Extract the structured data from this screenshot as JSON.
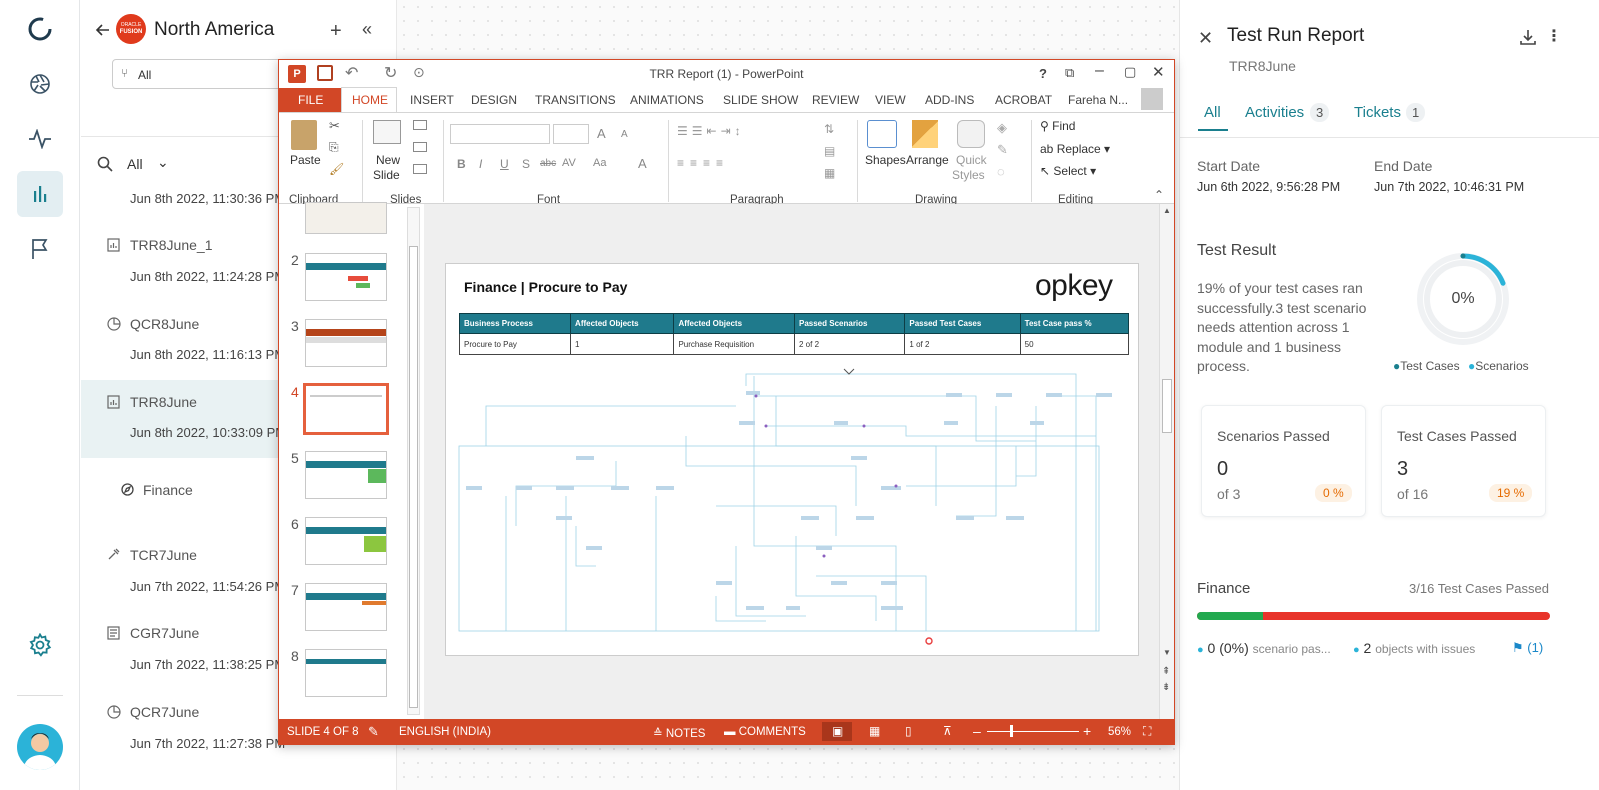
{
  "left_nav": {
    "items": [
      "logo-icon",
      "aperture-icon",
      "activity-icon",
      "bar-chart-icon",
      "flag-icon"
    ],
    "settings_icon": "gear-icon",
    "avatar": "avatar"
  },
  "list_panel": {
    "title": "North America",
    "badge": "ORACLE FUSION",
    "badge_top": "ORACLE",
    "badge_bottom": "FUSION",
    "filter_value": "All",
    "search_filter": "All",
    "partial_date": "Jun 8th 2022, 11:30:36 PM",
    "items": [
      {
        "title": "TRR8June_1",
        "date": "Jun 8th 2022, 11:24:28 PM",
        "icon": "report-icon"
      },
      {
        "title": "QCR8June",
        "date": "Jun 8th 2022, 11:16:13 PM",
        "icon": "pie-chart-icon"
      },
      {
        "title": "TRR8June",
        "date": "Jun 8th 2022, 10:33:09 PM",
        "icon": "report-icon"
      },
      {
        "title": "Finance",
        "date": "",
        "icon": "compass-icon"
      },
      {
        "title": "TCR7June",
        "date": "Jun 7th 2022, 11:54:26 PM",
        "icon": "tool-icon"
      },
      {
        "title": "CGR7June",
        "date": "Jun 7th 2022, 11:38:25 PM",
        "icon": "document-icon"
      },
      {
        "title": "QCR7June",
        "date": "Jun 7th 2022, 11:27:38 PM",
        "icon": "pie-chart-icon"
      }
    ]
  },
  "ppt": {
    "title": "TRR Report (1) - PowerPoint",
    "help": "?",
    "user": "Fareha N...",
    "tabs": [
      "FILE",
      "HOME",
      "INSERT",
      "DESIGN",
      "TRANSITIONS",
      "ANIMATIONS",
      "SLIDE SHOW",
      "REVIEW",
      "VIEW",
      "ADD-INS",
      "ACROBAT"
    ],
    "groups": [
      "Clipboard",
      "Slides",
      "Font",
      "Paragraph",
      "Drawing",
      "Editing"
    ],
    "buttons": {
      "paste": "Paste",
      "new_slide_1": "New",
      "new_slide_2": "Slide",
      "shapes": "Shapes",
      "arrange": "Arrange",
      "quick_1": "Quick",
      "quick_2": "Styles",
      "find": "Find",
      "replace": "Replace",
      "select": "Select"
    },
    "font_labels": {
      "bold": "B",
      "italic": "I",
      "underline": "U",
      "shadow": "S",
      "strike": "abc",
      "spacing": "AV",
      "case": "Aa",
      "color": "A",
      "grow": "A",
      "shrink": "A"
    },
    "slide_numbers": [
      "2",
      "3",
      "4",
      "5",
      "6",
      "7",
      "8"
    ],
    "slide": {
      "title": "Finance | Procure to Pay",
      "logo": "opkey",
      "headers": [
        "Business Process",
        "Affected Objects",
        "Affected Objects",
        "Passed Scenarios",
        "Passed Test Cases",
        "Test Case pass %"
      ],
      "row": [
        "Procure to Pay",
        "1",
        "Purchase Requisition",
        "2 of 2",
        "1 of 2",
        "50"
      ]
    },
    "status": {
      "slide": "SLIDE 4 OF 8",
      "language": "ENGLISH (INDIA)",
      "notes": "NOTES",
      "comments": "COMMENTS",
      "zoom": "56%"
    }
  },
  "report": {
    "title": "Test Run Report",
    "subtitle": "TRR8June",
    "tabs": [
      {
        "label": "All",
        "count": ""
      },
      {
        "label": "Activities",
        "count": "3"
      },
      {
        "label": "Tickets",
        "count": "1"
      }
    ],
    "start_label": "Start Date",
    "start_value": "Jun 6th 2022, 9:56:28 PM",
    "end_label": "End Date",
    "end_value": "Jun 7th 2022, 10:46:31 PM",
    "result_title": "Test Result",
    "result_text": "19% of your test cases ran successfully.3 test scenario needs attention across 1 module and 1 business process.",
    "donut_value": "0%",
    "donut_fraction": 0.19,
    "legend": [
      "Test Cases",
      "Scenarios"
    ],
    "scenarios_card": {
      "title": "Scenarios Passed",
      "value": "0",
      "of": "of 3",
      "pct": "0 %"
    },
    "testcases_card": {
      "title": "Test Cases Passed",
      "value": "3",
      "of": "of 16",
      "pct": "19 %"
    },
    "module": {
      "name": "Finance",
      "summary": "3/16 Test Cases Passed",
      "progress_green_fraction": 0.1875,
      "scenario_count": "0 (0%)",
      "scenario_text": "scenario pas...",
      "objects_count": "2",
      "objects_text": "objects with issues",
      "flag_count": "(1)"
    },
    "colors": {
      "accent": "#1a7f8e",
      "red": "#e8342a",
      "green": "#22a94f",
      "orange": "#e56a00",
      "ppt": "#d24726"
    }
  }
}
